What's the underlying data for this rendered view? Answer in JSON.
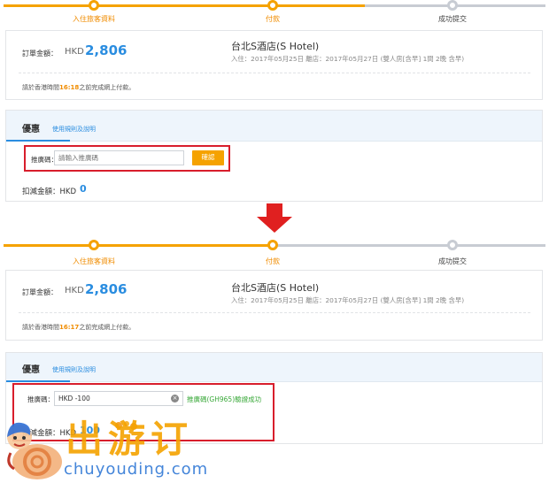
{
  "steps": [
    "入住旅客資料",
    "付款",
    "成功提交"
  ],
  "top_panel": {
    "order_label": "訂單金額：",
    "currency": "HKD",
    "amount": "2,806",
    "hotel_name": "台北S酒店(S Hotel)",
    "hotel_info": "入住：2017年05月25日 離店：2017年05月27日 (雙人房[含早] 1間 2晚 含早)",
    "pay_note_prefix": "請於香港時間",
    "pay_time": "16:18",
    "pay_note_suffix": "之前完成網上付款。",
    "promo_title": "優惠",
    "promo_rules": "使用規則及說明",
    "code_label": "推廣碼：",
    "code_placeholder": "請輸入推廣碼",
    "confirm_label": "確認",
    "discount_label": "扣減金額：HKD",
    "discount_value": "0"
  },
  "bottom_panel": {
    "order_label": "訂單金額：",
    "currency": "HKD",
    "amount": "2,806",
    "hotel_name": "台北S酒店(S Hotel)",
    "hotel_info": "入住：2017年05月25日 離店：2017年05月27日 (雙人房[含早] 1間 2晚 含早)",
    "pay_note_prefix": "請於香港時間",
    "pay_time": "16:17",
    "pay_note_suffix": "之前完成網上付款。",
    "promo_title": "優惠",
    "promo_rules": "使用規則及說明",
    "code_label": "推廣碼：",
    "code_value": "HKD -100",
    "success_message": "推廣碼(GH965)驗證成功",
    "discount_label": "扣減金額：HKD",
    "discount_value": "100"
  },
  "watermark": {
    "chinese": "出游订",
    "latin": "chuyouding.com"
  },
  "colors": {
    "accent": "#f5a200",
    "link_blue": "#2a8de0",
    "highlight_red": "#d81e2c",
    "success_green": "#38a838"
  },
  "icons": {
    "arrow": "down-arrow-icon",
    "clear": "clear-icon"
  }
}
